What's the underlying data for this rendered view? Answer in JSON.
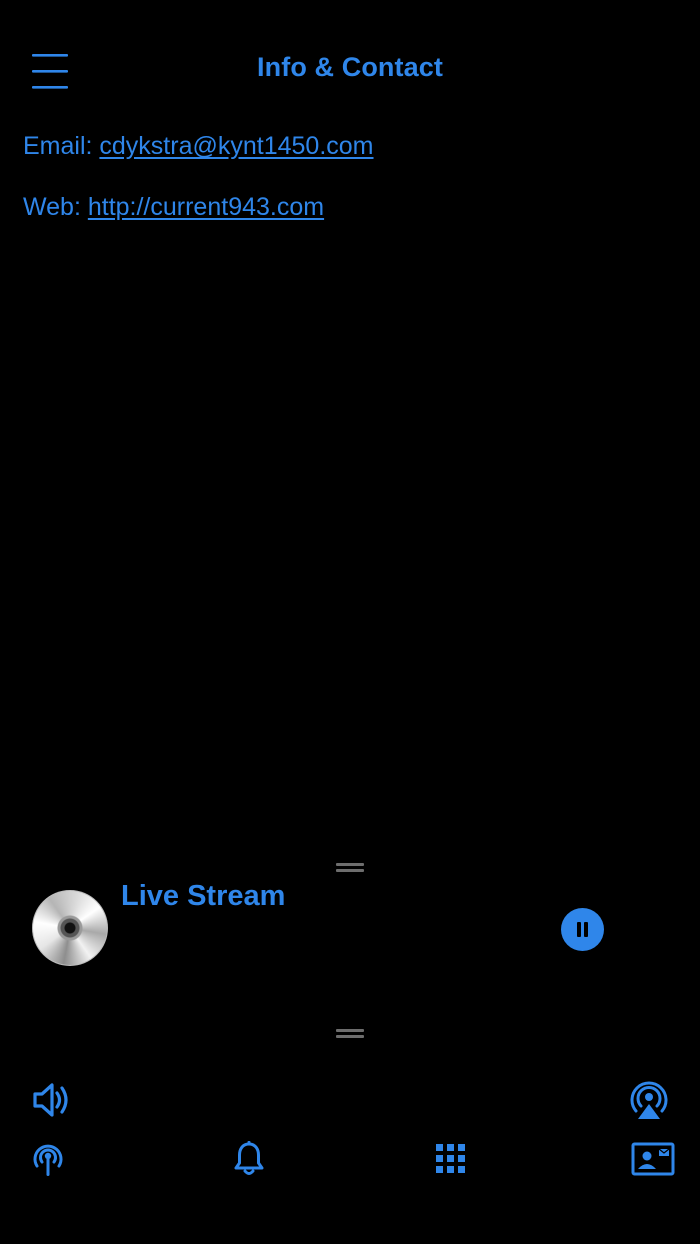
{
  "header": {
    "title": "Info & Contact",
    "menu_icon": "hamburger-menu-icon"
  },
  "contact": {
    "email_label": "Email: ",
    "email_value": "cdykstra@kynt1450.com",
    "web_label": "Web: ",
    "web_value": "http://current943.com"
  },
  "player": {
    "title": "Live Stream",
    "artwork_icon": "cd-disc-icon",
    "state_icon": "pause-icon"
  },
  "controls": {
    "volume_icon": "speaker-volume-icon",
    "airplay_icon": "airplay-icon"
  },
  "tabs": [
    {
      "icon": "broadcast-antenna-icon"
    },
    {
      "icon": "bell-icon"
    },
    {
      "icon": "grid-icon"
    },
    {
      "icon": "contact-card-icon"
    }
  ],
  "colors": {
    "accent": "#2f86ea",
    "background": "#000000"
  }
}
